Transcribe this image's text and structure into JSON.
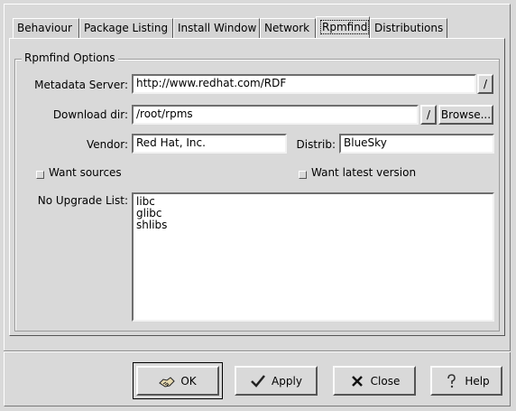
{
  "tabs": [
    {
      "label": "Behaviour"
    },
    {
      "label": "Package Listing"
    },
    {
      "label": "Install Window"
    },
    {
      "label": "Network"
    },
    {
      "label": "Rpmfind"
    },
    {
      "label": "Distributions"
    }
  ],
  "active_tab": "Rpmfind",
  "group_title": "Rpmfind Options",
  "metadata": {
    "label": "Metadata Server:",
    "value": "http://www.redhat.com/RDF",
    "btn": "/"
  },
  "download": {
    "label": "Download dir:",
    "value": "/root/rpms",
    "btn": "/",
    "browse": "Browse..."
  },
  "vendor": {
    "label": "Vendor:",
    "value": "Red Hat, Inc."
  },
  "distrib": {
    "label": "Distrib:",
    "value": "BlueSky"
  },
  "want_sources": {
    "label": "Want sources",
    "checked": false
  },
  "want_latest": {
    "label": "Want latest version",
    "checked": false
  },
  "no_upgrade": {
    "label": "No Upgrade List:",
    "items": [
      "libc",
      "glibc",
      "shlibs"
    ]
  },
  "buttons": {
    "ok": "OK",
    "apply": "Apply",
    "close": "Close",
    "help": "Help"
  }
}
